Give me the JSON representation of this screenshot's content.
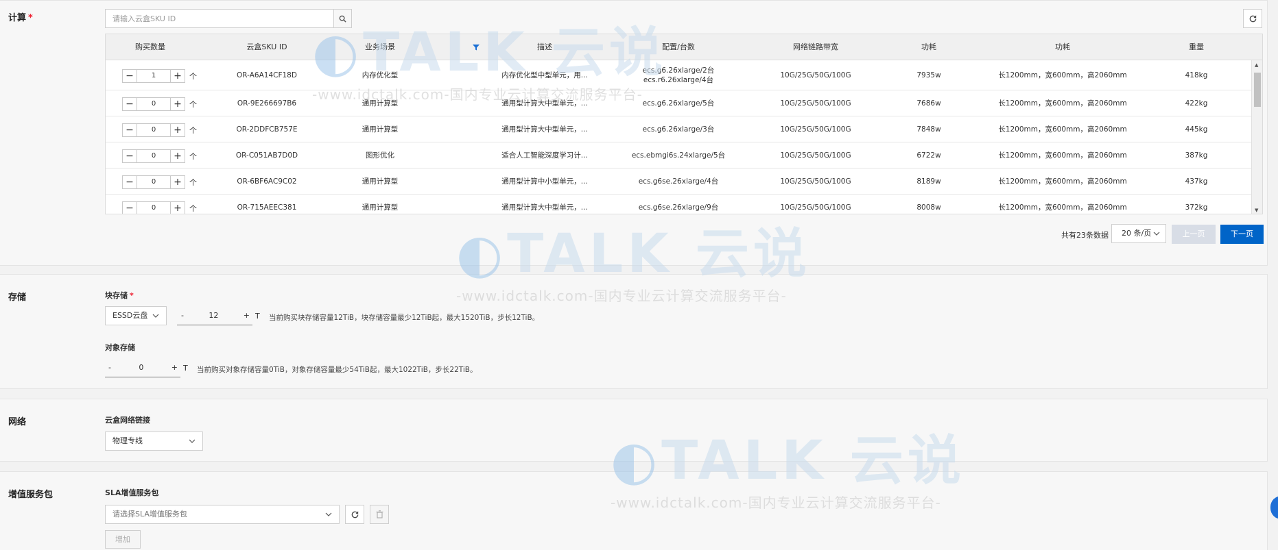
{
  "compute": {
    "title": "计算",
    "required_mark": "*",
    "search": {
      "placeholder": "请输入云盒SKU ID"
    },
    "columns": [
      "购买数量",
      "云盒SKU ID",
      "业务场景",
      "描述",
      "配置/台数",
      "网络链路带宽",
      "功耗",
      "功耗",
      "重量"
    ],
    "unit": "个",
    "rows": [
      {
        "qty": "1",
        "sku": "OR-A6A14CF18D",
        "scene": "内存优化型",
        "desc": "内存优化型中型单元，用...",
        "config": [
          "ecs.g6.26xlarge/2台",
          "ecs.r6.26xlarge/4台"
        ],
        "bandwidth": "10G/25G/50G/100G",
        "power": "7935w",
        "size": "长1200mm，宽600mm，高2060mm",
        "weight": "418kg"
      },
      {
        "qty": "0",
        "sku": "OR-9E266697B6",
        "scene": "通用计算型",
        "desc": "通用型计算大中型单元，...",
        "config": [
          "ecs.g6.26xlarge/5台"
        ],
        "bandwidth": "10G/25G/50G/100G",
        "power": "7686w",
        "size": "长1200mm，宽600mm，高2060mm",
        "weight": "422kg"
      },
      {
        "qty": "0",
        "sku": "OR-2DDFCB757E",
        "scene": "通用计算型",
        "desc": "通用型计算大中型单元，...",
        "config": [
          "ecs.g6.26xlarge/3台"
        ],
        "bandwidth": "10G/25G/50G/100G",
        "power": "7848w",
        "size": "长1200mm，宽600mm，高2060mm",
        "weight": "445kg"
      },
      {
        "qty": "0",
        "sku": "OR-C051AB7D0D",
        "scene": "图形优化",
        "desc": "适合人工智能深度学习计...",
        "config": [
          "ecs.ebmgi6s.24xlarge/5台"
        ],
        "bandwidth": "10G/25G/50G/100G",
        "power": "6722w",
        "size": "长1200mm，宽600mm，高2060mm",
        "weight": "387kg"
      },
      {
        "qty": "0",
        "sku": "OR-6BF6AC9C02",
        "scene": "通用计算型",
        "desc": "通用型计算中小型单元，...",
        "config": [
          "ecs.g6se.26xlarge/4台"
        ],
        "bandwidth": "10G/25G/50G/100G",
        "power": "8189w",
        "size": "长1200mm，宽600mm，高2060mm",
        "weight": "437kg"
      },
      {
        "qty": "0",
        "sku": "OR-715AEEC381",
        "scene": "通用计算型",
        "desc": "通用型计算大中型单元，...",
        "config": [
          "ecs.g6se.26xlarge/9台"
        ],
        "bandwidth": "10G/25G/50G/100G",
        "power": "8008w",
        "size": "长1200mm，宽600mm，高2060mm",
        "weight": "372kg"
      }
    ],
    "pagination": {
      "total": "共有23条数据",
      "page_size": "20 条/页",
      "prev": "上一页",
      "next": "下一页"
    }
  },
  "storage": {
    "title": "存储",
    "block_label": "块存储",
    "block_required": "*",
    "disk_type": "ESSD云盘",
    "block_value": "12",
    "block_minus": "-",
    "block_plus": "+",
    "block_unit": "T",
    "block_hint": "当前购买块存储容量12TiB，块存储容量最少12TiB起，最大1520TiB，步长12TiB。",
    "object_label": "对象存储",
    "object_value": "0",
    "object_minus": "-",
    "object_plus": "+",
    "object_unit": "T",
    "object_hint": "当前购买对象存储容量0TiB，对象存储容量最少54TiB起，最大1022TiB，步长22TiB。"
  },
  "network": {
    "title": "网络",
    "link_label": "云盒网络链接",
    "link_value": "物理专线"
  },
  "value_added": {
    "title": "增值服务包",
    "sla_label": "SLA增值服务包",
    "sla_placeholder": "请选择SLA增值服务包",
    "add_button": "增加"
  },
  "watermark": {
    "logo": "TALK 云说",
    "sub": "-www.idctalk.com-国内专业云计算交流服务平台-"
  },
  "colors": {
    "primary": "#0064c8",
    "required": "#e23",
    "filter": "#1a6fd4"
  }
}
